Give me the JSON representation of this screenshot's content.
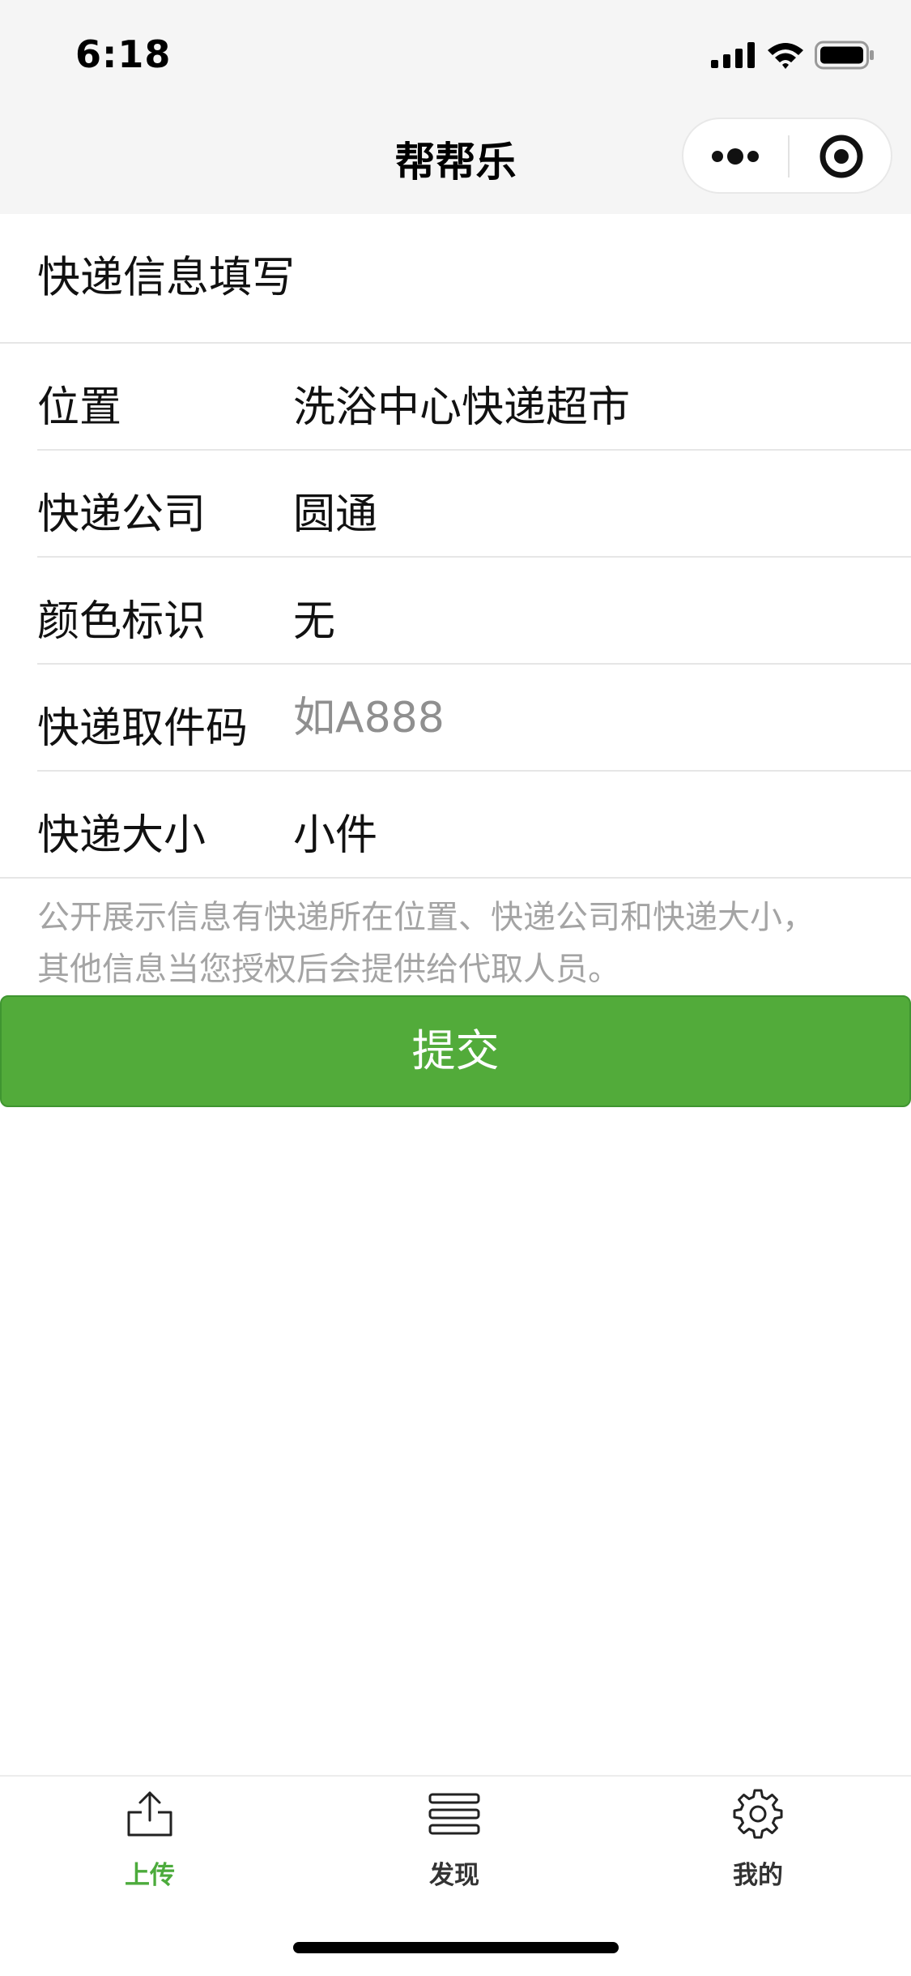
{
  "status_bar": {
    "time": "6:18",
    "icons": [
      "cellular-signal-icon",
      "wifi-icon",
      "battery-icon"
    ]
  },
  "nav": {
    "title": "帮帮乐",
    "capsule": [
      "more-dots-icon",
      "close-target-icon"
    ]
  },
  "form": {
    "section_title": "快递信息填写",
    "fields": [
      {
        "label": "位置",
        "value": "洗浴中心快递超市"
      },
      {
        "label": "快递公司",
        "value": "圆通"
      },
      {
        "label": "颜色标识",
        "value": "无"
      },
      {
        "label": "快递取件码",
        "value": "",
        "placeholder": "如A888"
      },
      {
        "label": "快递大小",
        "value": "小件"
      }
    ],
    "note_line1": "公开展示信息有快递所在位置、快递公司和快递大小，",
    "note_line2": "其他信息当您授权后会提供给代取人员。",
    "submit_label": "提交"
  },
  "tabbar": {
    "tabs": [
      {
        "label": "上传",
        "icon": "upload-icon",
        "active": true
      },
      {
        "label": "发现",
        "icon": "list-icon",
        "active": false
      },
      {
        "label": "我的",
        "icon": "gear-icon",
        "active": false
      }
    ]
  },
  "colors": {
    "accent_green": "#52ab3a",
    "active_tab_green": "#4cab3c",
    "placeholder_gray": "#8f8f8f",
    "note_gray": "#a4a4a4"
  }
}
